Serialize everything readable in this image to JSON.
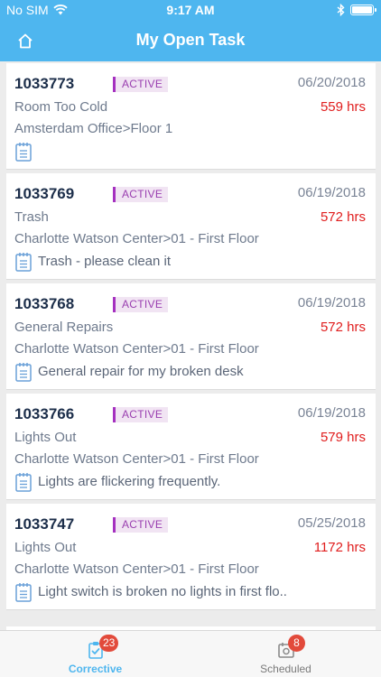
{
  "status_bar": {
    "carrier": "No SIM",
    "time": "9:17 AM"
  },
  "header": {
    "title": "My Open Task"
  },
  "tasks": [
    {
      "id": "1033773",
      "status": "ACTIVE",
      "date": "06/20/2018",
      "title": "Room Too Cold",
      "hours": "559 hrs",
      "location": "Amsterdam Office>Floor 1",
      "note": ""
    },
    {
      "id": "1033769",
      "status": "ACTIVE",
      "date": "06/19/2018",
      "title": "Trash",
      "hours": "572 hrs",
      "location": "Charlotte Watson Center>01 - First Floor",
      "note": "Trash - please clean it"
    },
    {
      "id": "1033768",
      "status": "ACTIVE",
      "date": "06/19/2018",
      "title": "General Repairs",
      "hours": "572 hrs",
      "location": "Charlotte Watson Center>01 - First Floor",
      "note": "General repair for my broken desk"
    },
    {
      "id": "1033766",
      "status": "ACTIVE",
      "date": "06/19/2018",
      "title": "Lights Out",
      "hours": "579 hrs",
      "location": "Charlotte Watson Center>01 - First Floor",
      "note": "Lights are flickering frequently."
    },
    {
      "id": "1033747",
      "status": "ACTIVE",
      "date": "05/25/2018",
      "title": "Lights Out",
      "hours": "1172 hrs",
      "location": "Charlotte Watson Center>01 - First Floor",
      "note": "Light switch is broken no lights in first flo.."
    }
  ],
  "tabs": [
    {
      "label": "Corrective",
      "badge": "23",
      "icon": "clipboard-check-icon",
      "active": true
    },
    {
      "label": "Scheduled",
      "badge": "8",
      "icon": "calendar-camera-icon",
      "active": false
    }
  ],
  "colors": {
    "accent": "#4eb6ef",
    "hours": "#e01d1d",
    "badge": "#e24a3b",
    "status": "#9a3fb0"
  }
}
